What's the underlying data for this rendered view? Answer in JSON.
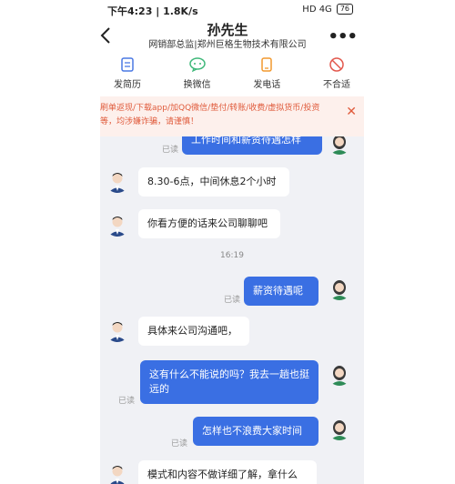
{
  "status_bar": {
    "time": "下午4:23",
    "speed": "1.8K/s",
    "right": "HD 4G",
    "battery": "76"
  },
  "header": {
    "title": "孙先生",
    "subtitle": "网销部总监|郑州巨格生物技术有限公司"
  },
  "actions": [
    {
      "label": "发简历"
    },
    {
      "label": "换微信"
    },
    {
      "label": "发电话"
    },
    {
      "label": "不合适"
    }
  ],
  "warning": {
    "text": "刷单返现/下载app/加QQ微信/垫付/转账/收费/虚拟货币/投资等，均涉嫌诈骗，请谨慎！"
  },
  "messages": [
    {
      "side": "right",
      "text": "工作时间和薪资待遇怎样",
      "read": "已读"
    },
    {
      "side": "left",
      "text": "8.30-6点，中间休息2个小时"
    },
    {
      "side": "left",
      "text": "你看方便的话来公司聊聊吧"
    },
    {
      "side": "time",
      "text": "16:19"
    },
    {
      "side": "right",
      "text": "薪资待遇呢",
      "read": "已读"
    },
    {
      "side": "left",
      "text": "具体来公司沟通吧，"
    },
    {
      "side": "right",
      "text": "这有什么不能说的吗？我去一趟也挺远的",
      "read": "已读"
    },
    {
      "side": "right",
      "text": "怎样也不浪费大家时间",
      "read": "已读"
    },
    {
      "side": "left",
      "text": "模式和内容不做详细了解，拿什么"
    }
  ]
}
